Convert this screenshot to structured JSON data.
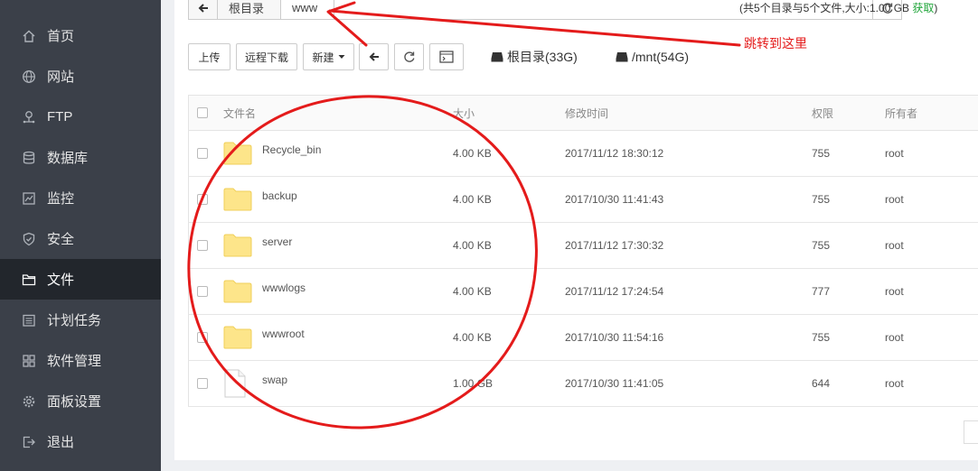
{
  "sidebar": {
    "items": [
      {
        "label": "首页",
        "icon": "home-icon"
      },
      {
        "label": "网站",
        "icon": "globe-icon"
      },
      {
        "label": "FTP",
        "icon": "ftp-icon"
      },
      {
        "label": "数据库",
        "icon": "database-icon"
      },
      {
        "label": "监控",
        "icon": "monitor-icon"
      },
      {
        "label": "安全",
        "icon": "shield-icon"
      },
      {
        "label": "文件",
        "icon": "folder-icon",
        "active": true
      },
      {
        "label": "计划任务",
        "icon": "calendar-icon"
      },
      {
        "label": "软件管理",
        "icon": "apps-icon"
      },
      {
        "label": "面板设置",
        "icon": "gear-icon"
      },
      {
        "label": "退出",
        "icon": "logout-icon"
      }
    ]
  },
  "pathbar": {
    "crumbs": [
      "根目录",
      "www"
    ],
    "summary": "(共5个目录与5个文件,大小:1.00 GB",
    "summary_link": "获取",
    "summary_end": ")"
  },
  "toolbar": {
    "upload": "上传",
    "remote_download": "远程下载",
    "new": "新建",
    "disks": [
      "根目录(33G)",
      "/mnt(54G)"
    ]
  },
  "annotation": {
    "text": "跳转到这里",
    "color": "#e41b1b"
  },
  "table": {
    "headers": [
      "文件名",
      "大小",
      "修改时间",
      "权限",
      "所有者"
    ],
    "rows": [
      {
        "name": "Recycle_bin",
        "size": "4.00 KB",
        "mtime": "2017/11/12 18:30:12",
        "perm": "755",
        "owner": "root",
        "type": "folder"
      },
      {
        "name": "backup",
        "size": "4.00 KB",
        "mtime": "2017/10/30 11:41:43",
        "perm": "755",
        "owner": "root",
        "type": "folder"
      },
      {
        "name": "server",
        "size": "4.00 KB",
        "mtime": "2017/11/12 17:30:32",
        "perm": "755",
        "owner": "root",
        "type": "folder"
      },
      {
        "name": "wwwlogs",
        "size": "4.00 KB",
        "mtime": "2017/11/12 17:24:54",
        "perm": "777",
        "owner": "root",
        "type": "folder"
      },
      {
        "name": "wwwroot",
        "size": "4.00 KB",
        "mtime": "2017/10/30 11:54:16",
        "perm": "755",
        "owner": "root",
        "type": "folder"
      },
      {
        "name": "swap",
        "size": "1.00 GB",
        "mtime": "2017/10/30 11:41:05",
        "perm": "644",
        "owner": "root",
        "type": "file"
      }
    ]
  },
  "colors": {
    "sidebar_bg": "#3b4049",
    "sidebar_active": "#22262c",
    "folder": "#fde58a",
    "accent_green": "#20a53a"
  }
}
